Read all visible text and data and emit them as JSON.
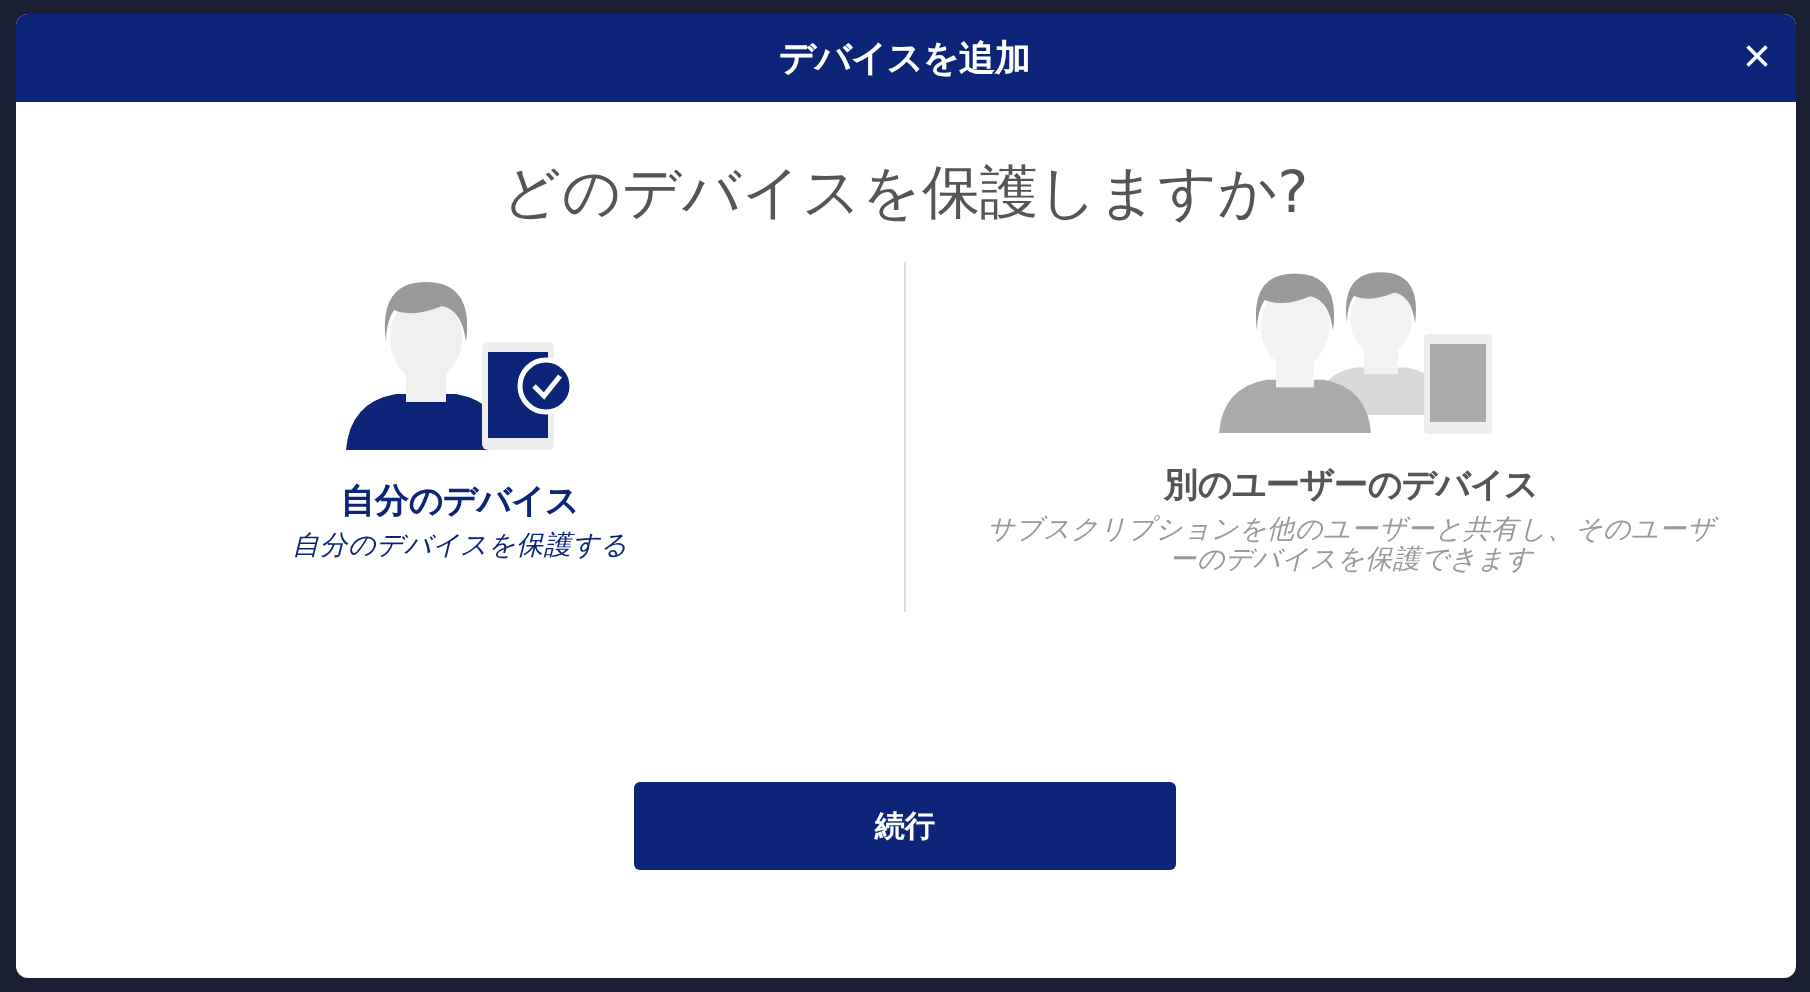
{
  "dialog": {
    "title": "デバイスを追加",
    "close": "×"
  },
  "question": "どのデバイスを保護しますか?",
  "options": [
    {
      "kind": "self",
      "title": "自分のデバイス",
      "description": "自分のデバイスを保護する",
      "selected": true
    },
    {
      "kind": "other",
      "title": "別のユーザーのデバイス",
      "description": "サブスクリプションを他のユーザーと共有し、そのユーザーのデバイスを保護できます",
      "selected": false
    }
  ],
  "continue_button": "続行"
}
